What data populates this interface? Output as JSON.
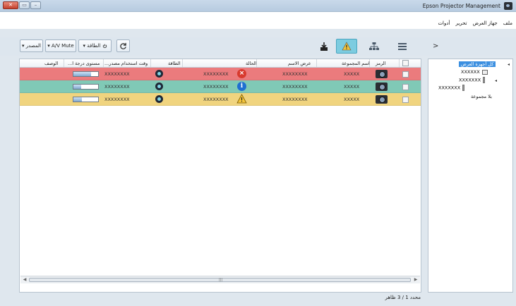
{
  "window": {
    "title": "Epson Projector Management",
    "min_symbol": "–",
    "max_symbol": "▭",
    "close_symbol": "✕",
    "icon": "projector-app-icon"
  },
  "menu": {
    "items": [
      "ملف",
      "جهاز العرض",
      "تحرير",
      "أدوات"
    ]
  },
  "toolbar": {
    "source_label": "▾ المصدر",
    "avmute_label": "▾ A/V Mute",
    "power_label": "▾ الطاقة",
    "power_icon": "power-icon",
    "refresh_icon": "refresh-icon",
    "chevron": ">",
    "views": [
      {
        "name": "list-view",
        "icon": "list-icon",
        "active": false
      },
      {
        "name": "group-view",
        "icon": "network-icon",
        "active": false
      },
      {
        "name": "alert-view",
        "icon": "alert-icon",
        "active": true
      },
      {
        "name": "download-view",
        "icon": "download-icon",
        "active": false
      }
    ]
  },
  "table": {
    "columns": [
      "الرمز",
      "اسم المجموعة",
      "عرض الاسم",
      "الحالة",
      "الطاقة",
      "وقت استخدام مصدر...",
      "مستوى درجة ا...",
      "الوصف"
    ],
    "rows": [
      {
        "bg": "#eb7b7d",
        "group": "XXXXX",
        "display_name": "XXXXXXXX",
        "status": "XXXXXXXX",
        "status_icon": "error-icon",
        "power_icon": "power-on-icon",
        "lamp_hours": "XXXXXXXX",
        "lamp_level": 0.7
      },
      {
        "bg": "#80c9b6",
        "group": "XXXXX",
        "display_name": "XXXXXXXX",
        "status": "XXXXXXXX",
        "status_icon": "info-icon",
        "power_icon": "power-on-icon",
        "lamp_hours": "XXXXXXXX",
        "lamp_level": 0.3
      },
      {
        "bg": "#f0d47f",
        "group": "XXXXX",
        "display_name": "XXXXXXXX",
        "status": "XXXXXXXX",
        "status_icon": "warning-icon",
        "power_icon": "power-on-icon",
        "lamp_hours": "XXXXXXXX",
        "lamp_level": 0.35
      }
    ]
  },
  "pager": {
    "label": "محدد 1 / 3 ظاهر"
  },
  "tree": {
    "root": "كل أجهزة العرض",
    "nodes": [
      "XXXXXX",
      "XXXXXXX",
      "XXXXXXX"
    ],
    "ungrouped": "بلا مجموعة"
  },
  "colors": {
    "error_row": "#eb7b7d",
    "info_row": "#80c9b6",
    "warning_row": "#f0d47f",
    "selection": "#3b8fe0",
    "active_view": "#7ccce0"
  }
}
